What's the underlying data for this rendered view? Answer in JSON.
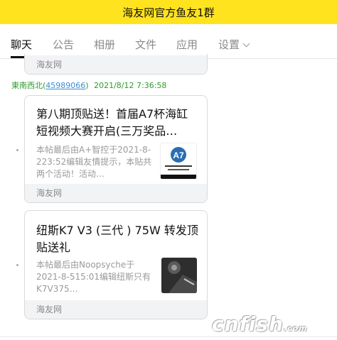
{
  "header": {
    "title": "海友网官方鱼友1群"
  },
  "tabs": [
    {
      "label": "聊天"
    },
    {
      "label": "公告"
    },
    {
      "label": "相册"
    },
    {
      "label": "文件"
    },
    {
      "label": "应用"
    },
    {
      "label": "设置"
    }
  ],
  "prev_card": {
    "footer": "海友网"
  },
  "message": {
    "sender_name": "東南西北(",
    "sender_id": "45989066",
    "sender_close": ")",
    "timestamp": "2021/8/12 7:36:58"
  },
  "cards": [
    {
      "title": "第八期顶贴送！首届A7杯海缸短视频大赛开启(三万奖品…",
      "desc": "本帖最后由A+智控于2021-8-223:52编辑友情提示，本贴共两个活动！活动…",
      "footer": "海友网",
      "thumb_icon": "a7-logo-thumbnail-icon"
    },
    {
      "title": "纽斯K7 V3 (三代 ) 75W 转发顶贴送礼",
      "desc": "本帖最后由Noopsyche于2021-8-515:01编辑纽斯只有K7V375…",
      "footer": "海友网",
      "thumb_icon": "product-photo-thumbnail-icon"
    }
  ],
  "watermark": {
    "text": "cnfish",
    "suffix": ".com"
  },
  "colors": {
    "header_bg": "#ffe31f",
    "sender_green": "#2e9b2e",
    "link_blue": "#3b8dd8"
  }
}
